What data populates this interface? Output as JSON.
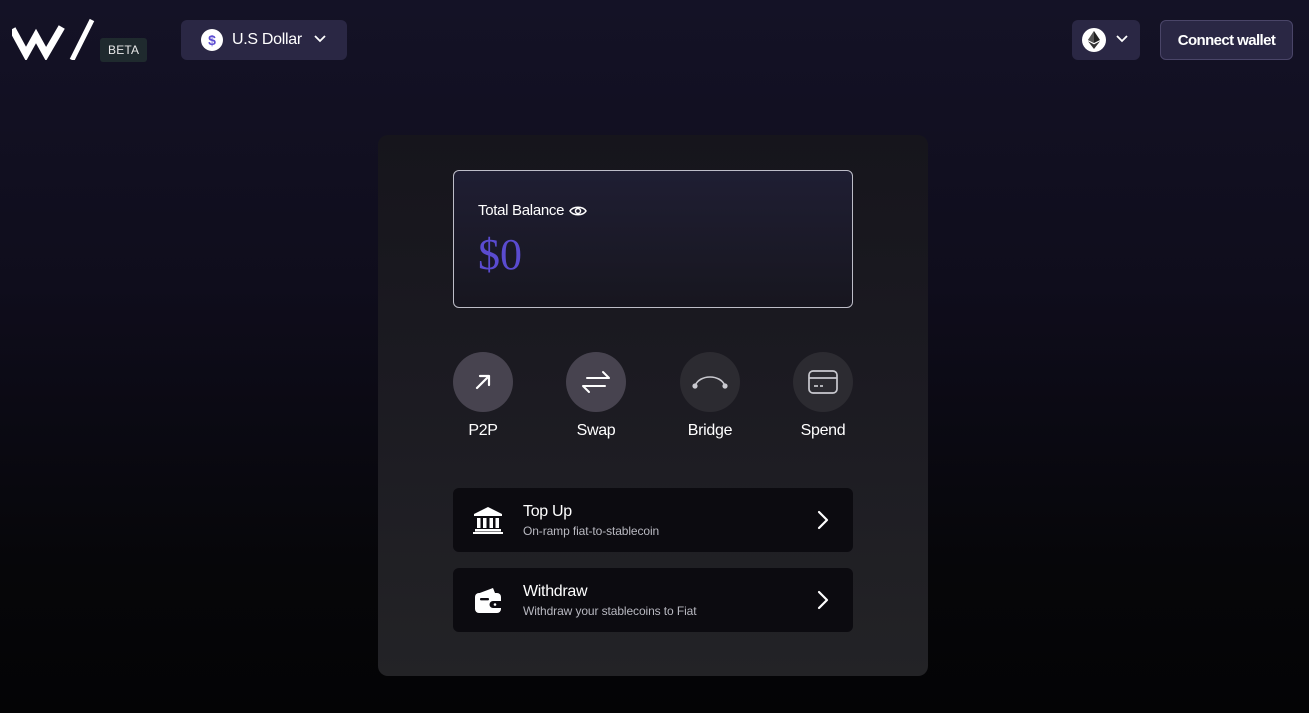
{
  "header": {
    "beta_label": "BETA",
    "currency": {
      "label": "U.S Dollar",
      "icon": "dollar-icon",
      "symbol": "$"
    },
    "network": {
      "icon": "ethereum-icon"
    },
    "connect_label": "Connect wallet"
  },
  "balance": {
    "title": "Total Balance",
    "value": "$0",
    "accent_color": "#5a4bd0"
  },
  "actions": [
    {
      "label": "P2P",
      "icon": "arrow-up-right-icon"
    },
    {
      "label": "Swap",
      "icon": "swap-arrows-icon"
    },
    {
      "label": "Bridge",
      "icon": "bridge-icon"
    },
    {
      "label": "Spend",
      "icon": "card-icon"
    }
  ],
  "rows": [
    {
      "title": "Top Up",
      "subtitle": "On-ramp fiat-to-stablecoin",
      "icon": "bank-icon"
    },
    {
      "title": "Withdraw",
      "subtitle": "Withdraw your stablecoins to Fiat",
      "icon": "wallet-icon"
    }
  ]
}
